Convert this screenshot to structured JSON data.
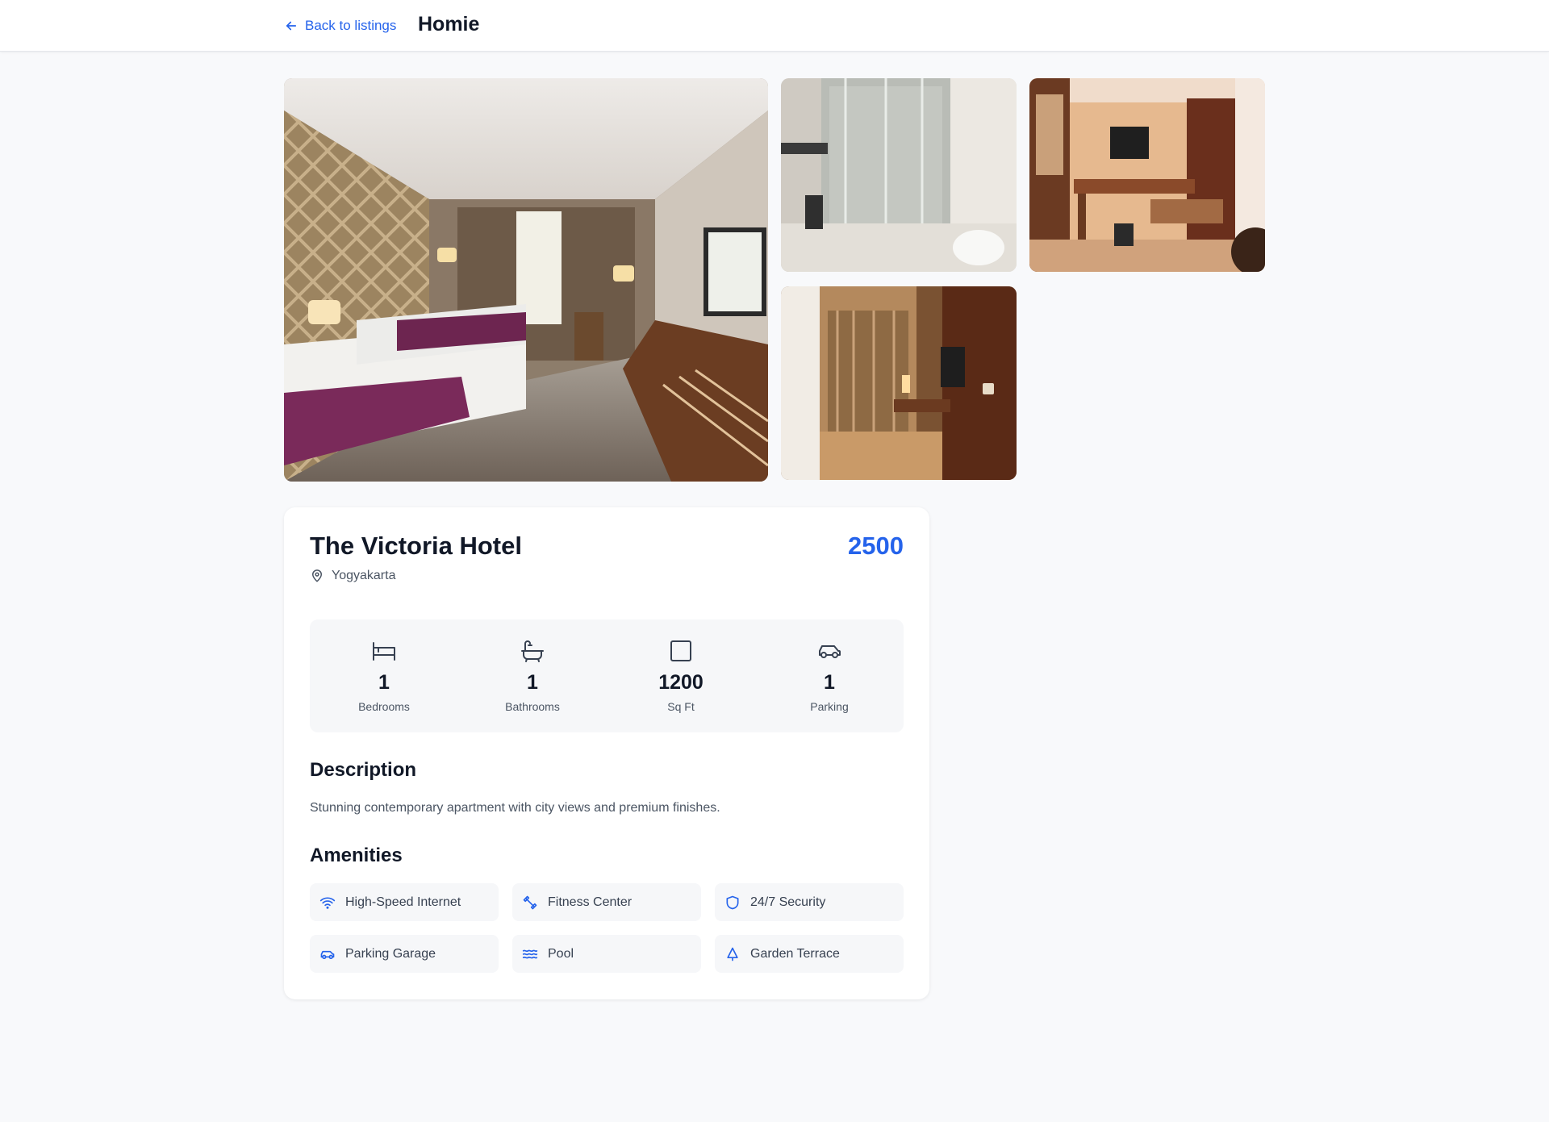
{
  "header": {
    "back_label": "Back to listings",
    "brand": "Homie",
    "back_icon": "arrow-left-icon"
  },
  "gallery": {
    "images": [
      {
        "name": "bedroom-main-photo",
        "alt": "The Victoria Hotel"
      },
      {
        "name": "bathroom-photo",
        "alt": "The Victoria Hotel"
      },
      {
        "name": "desk-tv-photo",
        "alt": "The Victoria Hotel"
      },
      {
        "name": "hallway-photo",
        "alt": "The Victoria Hotel"
      }
    ]
  },
  "listing": {
    "title": "The Victoria Hotel",
    "price": "2500",
    "location": "Yogyakarta",
    "location_icon": "map-pin-icon"
  },
  "stats": [
    {
      "icon": "bed-icon",
      "value": "1",
      "label": "Bedrooms"
    },
    {
      "icon": "bath-icon",
      "value": "1",
      "label": "Bathrooms"
    },
    {
      "icon": "square-icon",
      "value": "1200",
      "label": "Sq Ft"
    },
    {
      "icon": "car-icon",
      "value": "1",
      "label": "Parking"
    }
  ],
  "description": {
    "heading": "Description",
    "text": "Stunning contemporary apartment with city views and premium finishes."
  },
  "amenities": {
    "heading": "Amenities",
    "items": [
      {
        "icon": "wifi-icon",
        "label": "High-Speed Internet"
      },
      {
        "icon": "dumbbell-icon",
        "label": "Fitness Center"
      },
      {
        "icon": "shield-icon",
        "label": "24/7 Security"
      },
      {
        "icon": "car-icon",
        "label": "Parking Garage"
      },
      {
        "icon": "waves-icon",
        "label": "Pool"
      },
      {
        "icon": "tree-icon",
        "label": "Garden Terrace"
      }
    ]
  },
  "colors": {
    "accent": "#2563eb",
    "text": "#111827",
    "muted": "#4b5563",
    "page_bg": "#f8f9fb",
    "card_bg": "#ffffff",
    "tile_bg": "#f6f7f9"
  }
}
